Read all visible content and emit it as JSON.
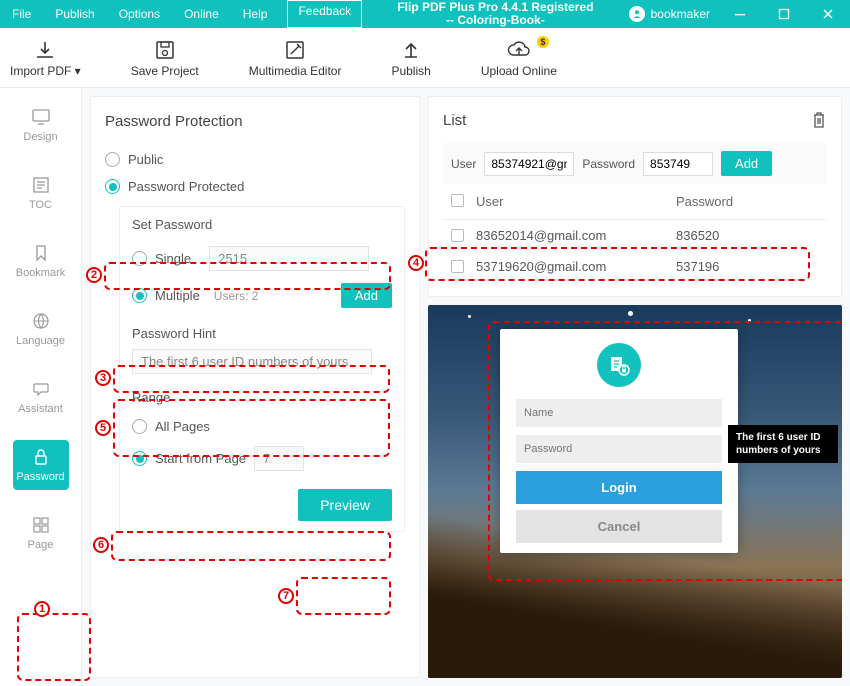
{
  "title": "Flip PDF Plus Pro 4.4.1 Registered\n-- Coloring-Book-",
  "menus": [
    "File",
    "Publish",
    "Options",
    "Online",
    "Help"
  ],
  "feedback_label": "Feedback",
  "user_name": "bookmaker",
  "toolbar": {
    "import": "Import PDF ▾",
    "save": "Save Project",
    "mm": "Multimedia Editor",
    "publish": "Publish",
    "upload": "Upload Online",
    "upload_badge": "$"
  },
  "sidebar": {
    "items": [
      {
        "label": "Design"
      },
      {
        "label": "TOC"
      },
      {
        "label": "Bookmark"
      },
      {
        "label": "Language"
      },
      {
        "label": "Assistant"
      },
      {
        "label": "Password"
      },
      {
        "label": "Page"
      }
    ]
  },
  "center": {
    "heading": "Password Protection",
    "opt_public": "Public",
    "opt_protected": "Password Protected",
    "set_password": "Set Password",
    "opt_single": "Single",
    "single_val": "2515",
    "opt_multiple": "Multiple",
    "users_count": "Users: 2",
    "add_btn": "Add",
    "hint_label": "Password Hint",
    "hint_val": "The first 6 user ID numbers of yours",
    "range": "Range",
    "all_pages": "All Pages",
    "start_from": "Start from Page",
    "start_val": "7",
    "preview": "Preview"
  },
  "right": {
    "list_heading": "List",
    "user_label": "User",
    "pass_label": "Password",
    "add_user_val": "85374921@gm",
    "add_pass_val": "853749",
    "add_btn": "Add",
    "rows": [
      {
        "user": "83652014@gmail.com",
        "pass": "836520"
      },
      {
        "user": "53719620@gmail.com",
        "pass": "537196"
      }
    ]
  },
  "preview": {
    "name_ph": "Name",
    "pass_ph": "Password",
    "login": "Login",
    "cancel": "Cancel",
    "tooltip": "The first 6 user ID numbers of yours"
  },
  "anno_labels": [
    "1",
    "2",
    "3",
    "4",
    "5",
    "6",
    "7"
  ]
}
